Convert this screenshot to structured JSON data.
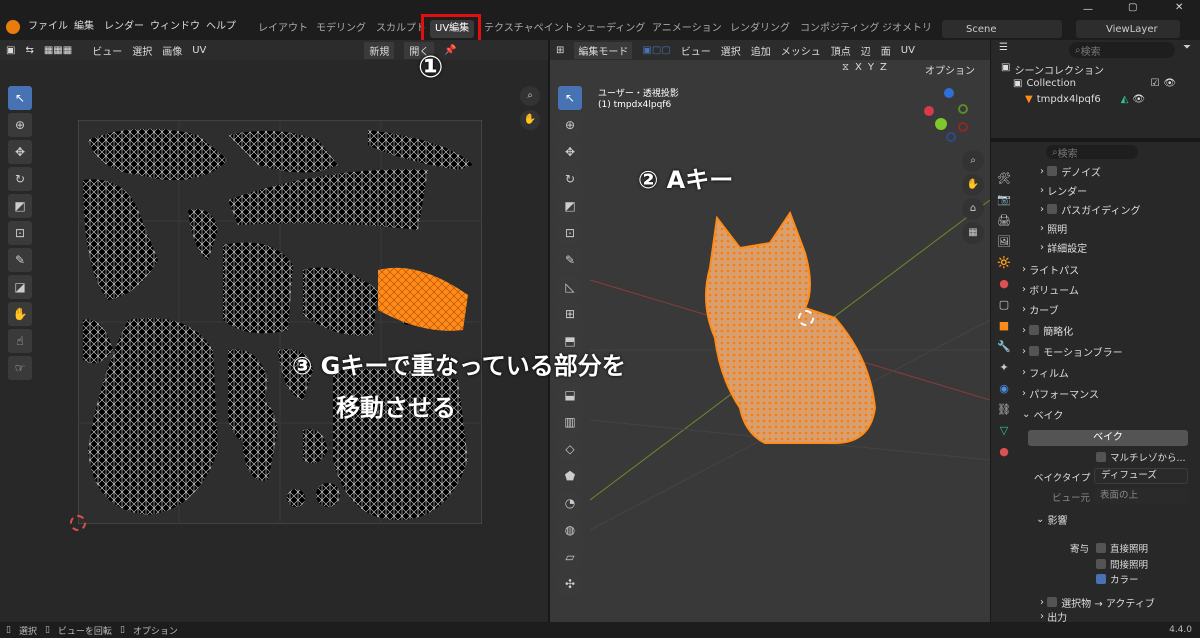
{
  "menu": [
    "ファイル",
    "編集",
    "レンダー",
    "ウィンドウ",
    "ヘルプ"
  ],
  "workspaces": [
    "レイアウト",
    "モデリング",
    "スカルプト",
    "UV編集",
    "テクスチャペイント",
    "シェーディング",
    "アニメーション",
    "レンダリング",
    "コンポジティング",
    "ジオメトリ"
  ],
  "scene": "Scene",
  "viewlayer": "ViewLayer",
  "uv_header": {
    "items": [
      "ビュー",
      "選択",
      "画像",
      "UV"
    ],
    "new_label": "新規",
    "open_label": "開く"
  },
  "viewport_header": {
    "mode": "編集モード",
    "items": [
      "ビュー",
      "選択",
      "追加",
      "メッシュ",
      "頂点",
      "辺",
      "面",
      "UV"
    ],
    "axes": [
      "X",
      "Y",
      "Z"
    ],
    "option": "オプション"
  },
  "viewport_info": {
    "line1": "ユーザー・透視投影",
    "line2": "(1) tmpdx4lpqf6"
  },
  "annotations": {
    "a1": "①",
    "a2": "② Aキー",
    "a3_line1": "③ Gキーで重なっている部分を",
    "a3_line2": "移動させる"
  },
  "outliner": {
    "search_placeholder": "検索",
    "scene_collection": "シーンコレクション",
    "collection": "Collection",
    "object": "tmpdx4lpqf6"
  },
  "properties": {
    "search_placeholder": "検索",
    "render_sub": [
      "デノイズ",
      "レンダー",
      "パスガイディング",
      "照明",
      "詳細設定"
    ],
    "panels": [
      "ライトパス",
      "ボリューム",
      "カーブ",
      "簡略化",
      "モーションブラー",
      "フィルム",
      "パフォーマンス",
      "ベイク"
    ],
    "bake_button": "ベイク",
    "multires": "マルチレゾから...",
    "bake_type_label": "ベイクタイプ",
    "bake_type_value": "ディフューズ",
    "view_from_label": "ビュー元",
    "view_from_value": "表面の上",
    "influence": "影響",
    "contrib_label": "寄与",
    "direct": "直接照明",
    "indirect": "間接照明",
    "color": "カラー",
    "sel_to_active": "選択物 → アクティブ",
    "output": "出力"
  },
  "status": {
    "select": "選択",
    "rotate": "ビューを回転",
    "options": "オプション",
    "version": "4.4.0"
  },
  "colors": {
    "accent": "#4772b3",
    "orange": "#ff8c1a",
    "highlight": "#e01010"
  }
}
